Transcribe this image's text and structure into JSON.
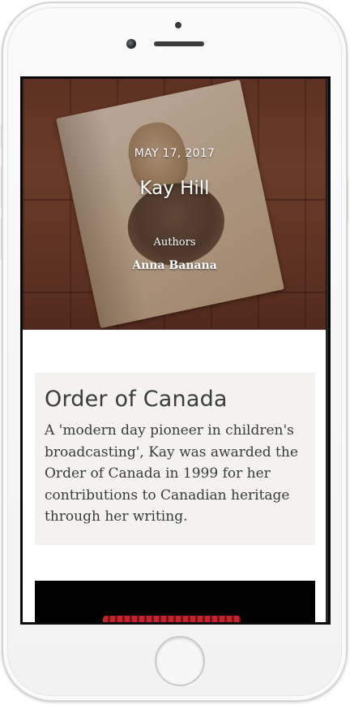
{
  "hero": {
    "date": "MAY 17, 2017",
    "title": "Kay Hill",
    "authors_label": "Authors",
    "author_name": "Anna Banana"
  },
  "card": {
    "title": "Order of Canada",
    "body": "A 'modern day pioneer in children's broadcasting', Kay was awarded the Order of Canada in 1999 for her contributions to Canadian heritage through her writing."
  },
  "colors": {
    "card_background": "#f3f2ee",
    "wood": "#7c4632",
    "video_accent": "#c1252f"
  }
}
